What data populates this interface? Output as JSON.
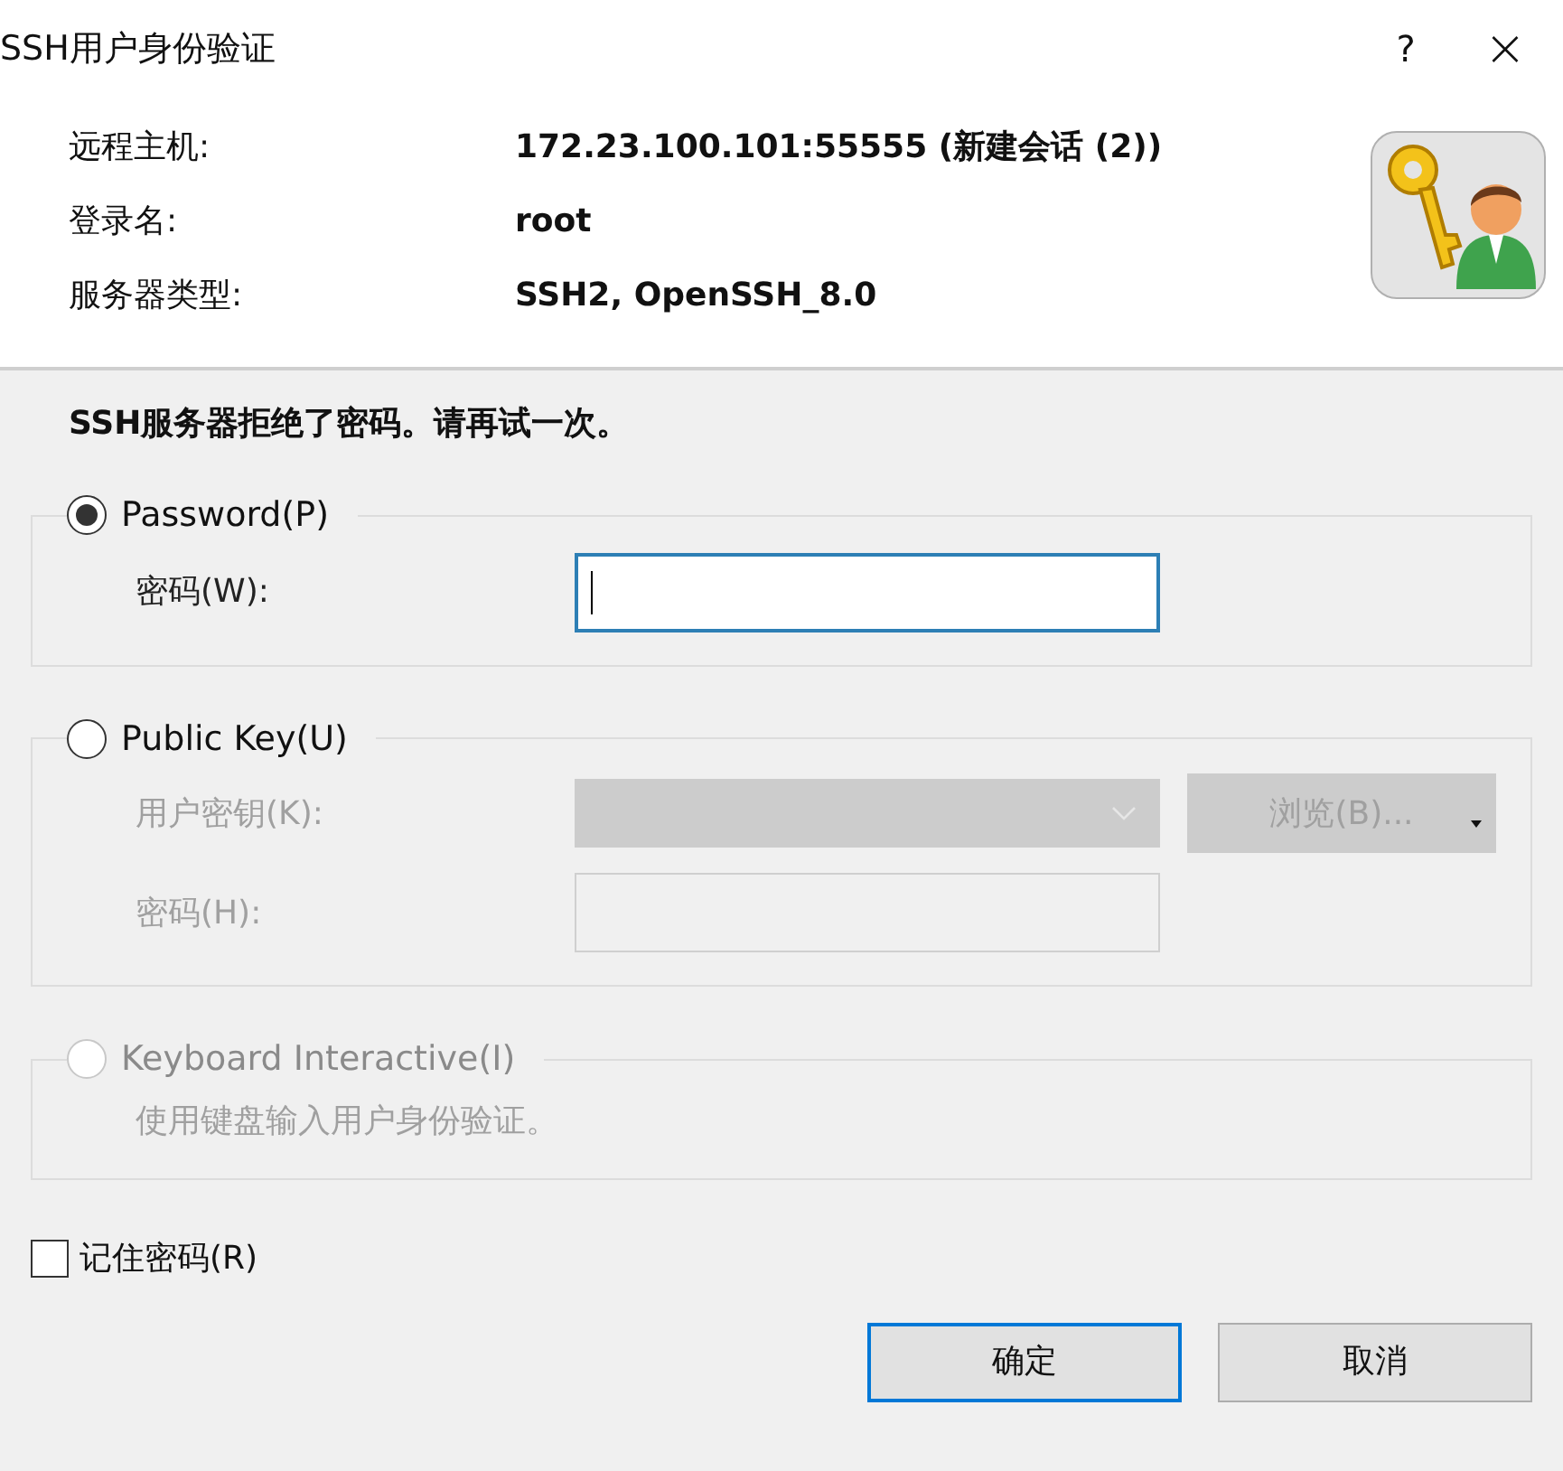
{
  "window": {
    "title": "SSH用户身份验证",
    "help": "?",
    "close": "×"
  },
  "info": [
    {
      "label": "远程主机:",
      "value": "172.23.100.101:55555 (新建会话 (2))"
    },
    {
      "label": "登录名:",
      "value": "root"
    },
    {
      "label": "服务器类型:",
      "value": "SSH2, OpenSSH_8.0"
    }
  ],
  "message": "SSH服务器拒绝了密码。请再试一次。",
  "methods": [
    {
      "label": "Password(P)",
      "selected": true,
      "disabled": false,
      "fields": [
        {
          "kind": "input",
          "label": "密码(W):",
          "focused": true
        }
      ]
    },
    {
      "label": "Public Key(U)",
      "selected": false,
      "disabled": false,
      "fields": [
        {
          "kind": "dropdown",
          "label": "用户密钥(K):",
          "disabled": true,
          "button": "浏览(B)..."
        },
        {
          "kind": "input",
          "label": "密码(H):",
          "disabled": true,
          "focused": false
        }
      ]
    },
    {
      "label": "Keyboard Interactive(I)",
      "selected": false,
      "disabled": true,
      "description": "使用键盘输入用户身份验证。"
    }
  ],
  "remember": {
    "label": "记住密码(R)",
    "checked": false
  },
  "buttons": [
    {
      "label": "确定",
      "default": true
    },
    {
      "label": "取消",
      "default": false
    }
  ]
}
